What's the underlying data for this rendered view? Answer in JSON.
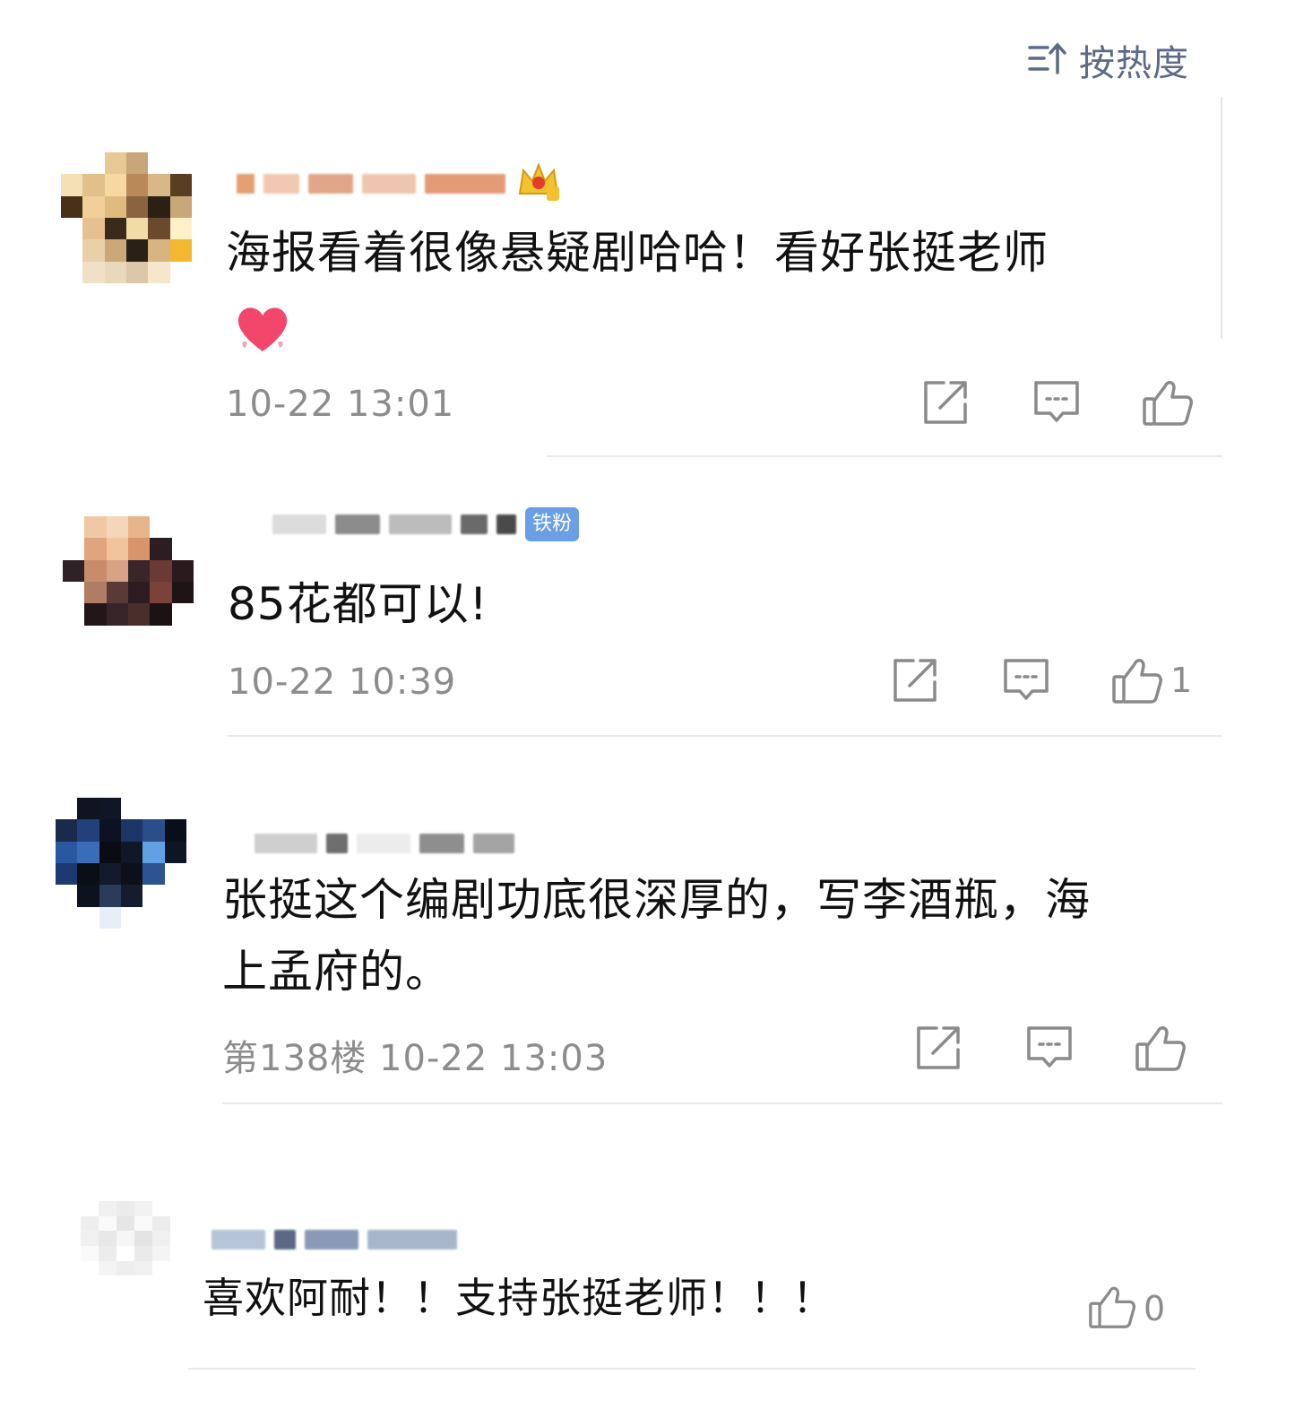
{
  "sort": {
    "label": "按热度",
    "icon": "sort-icon"
  },
  "comments": [
    {
      "text": "海报看着很像悬疑剧哈哈！看好张挺老师",
      "emoji": "heart-emoji",
      "badge": "crown-badge",
      "time": "10-22 13:01",
      "likes": ""
    },
    {
      "text": "85花都可以!",
      "badge_label": "铁粉",
      "time": "10-22 10:39",
      "likes": "1"
    },
    {
      "text_line1": "张挺这个编剧功底很深厚的，写李酒瓶，海",
      "text_line2": "上孟府的。",
      "time": "第138楼 10-22 13:03",
      "likes": ""
    },
    {
      "text": "喜欢阿耐！！支持张挺老师！！！",
      "likes": "0"
    }
  ],
  "icons": {
    "share": "share-icon",
    "reply": "comment-icon",
    "like": "thumbs-up-icon"
  }
}
